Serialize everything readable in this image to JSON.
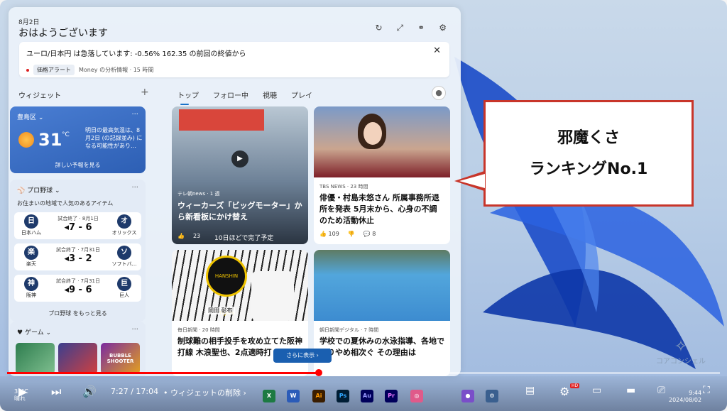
{
  "panel": {
    "date": "8月2日",
    "greeting": "おはようございます",
    "header_icons": [
      "refresh-icon",
      "expand-icon",
      "settings-icon",
      "gear-icon"
    ]
  },
  "alert": {
    "headline": "ユーロ/日本円 は急落しています: -0.56% 162.35 の前回の終値から",
    "chip": "価格アラート",
    "meta": "Money の分析情報 · 15 時間"
  },
  "widgets": {
    "title": "ウィジェット",
    "add": "+"
  },
  "tabs": [
    "トップ",
    "フォロー中",
    "視聴",
    "プレイ"
  ],
  "weather": {
    "location": "豊島区",
    "temp": "31",
    "unit": "°C",
    "forecast": "明日の最高気温は、8月2日 (の記録並み) になる可能性があり…",
    "link": "詳しい予報を見る"
  },
  "baseball": {
    "title": "プロ野球",
    "subtitle": "お住まいの地域で人気のあるアイテム",
    "games": [
      {
        "left_abbr": "日",
        "left": "日本ハム",
        "status": "試合終了 · 8月1日",
        "score": "◂7 - 6",
        "right_abbr": "オ",
        "right": "オリックス"
      },
      {
        "left_abbr": "楽",
        "left": "楽天",
        "status": "試合終了 · 7月31日",
        "score": "◂3 - 2",
        "right_abbr": "ソ",
        "right": "ソフトバ…"
      },
      {
        "left_abbr": "神",
        "left": "阪神",
        "status": "試合終了 · 7月31日",
        "score": "◂9 - 6",
        "right_abbr": "巨",
        "right": "巨人"
      }
    ],
    "link": "プロ野球 をもっと見る"
  },
  "games": {
    "title": "ゲーム",
    "tiles": [
      "Mahjong",
      "Blocks",
      "BUBBLE SHOOTER"
    ]
  },
  "news": [
    {
      "source": "テレ朝news · 1 週",
      "title": "ウィーカーズ「ビッグモーター」から新看板にかけ替え",
      "overlay": "10日ほどで完了予定",
      "likes": "23"
    },
    {
      "source": "TBS NEWS · 23 時間",
      "title": "俳優・村島未悠さん 所属事務所退所を発表 5月末から、心身の不調のため活動休止",
      "likes": "109",
      "comments": "8"
    },
    {
      "source": "毎日新聞 · 20 時間",
      "title": "制球難の相手投手を攻め立てた阪神打線 木浪聖也、2点適時打",
      "img_text": "HANSHIN Tigers",
      "caption": "岡田 彰布"
    },
    {
      "source": "朝日新聞デジタル · 7 時間",
      "title": "学校での夏休みの水泳指導、各地で取りやめ相次ぐ その理由は"
    }
  ],
  "more_button": "さらに表示",
  "callout": {
    "line1": "邪魔くさ",
    "line2": "ランキングNo.1"
  },
  "player": {
    "time": "7:27 / 17:04",
    "chapter": "• ウィジェットの削除 ›",
    "progress": 0.4375,
    "hd": "HD"
  },
  "taskbar": {
    "weather": "31°C",
    "weather_sub": "晴れ",
    "clock": "9:44",
    "date": "2024/08/02"
  },
  "watermark": "コアコンシェル",
  "colors": {
    "accent": "#1a73c9",
    "callout_border": "#c8352a",
    "progress": "#ff0000"
  }
}
